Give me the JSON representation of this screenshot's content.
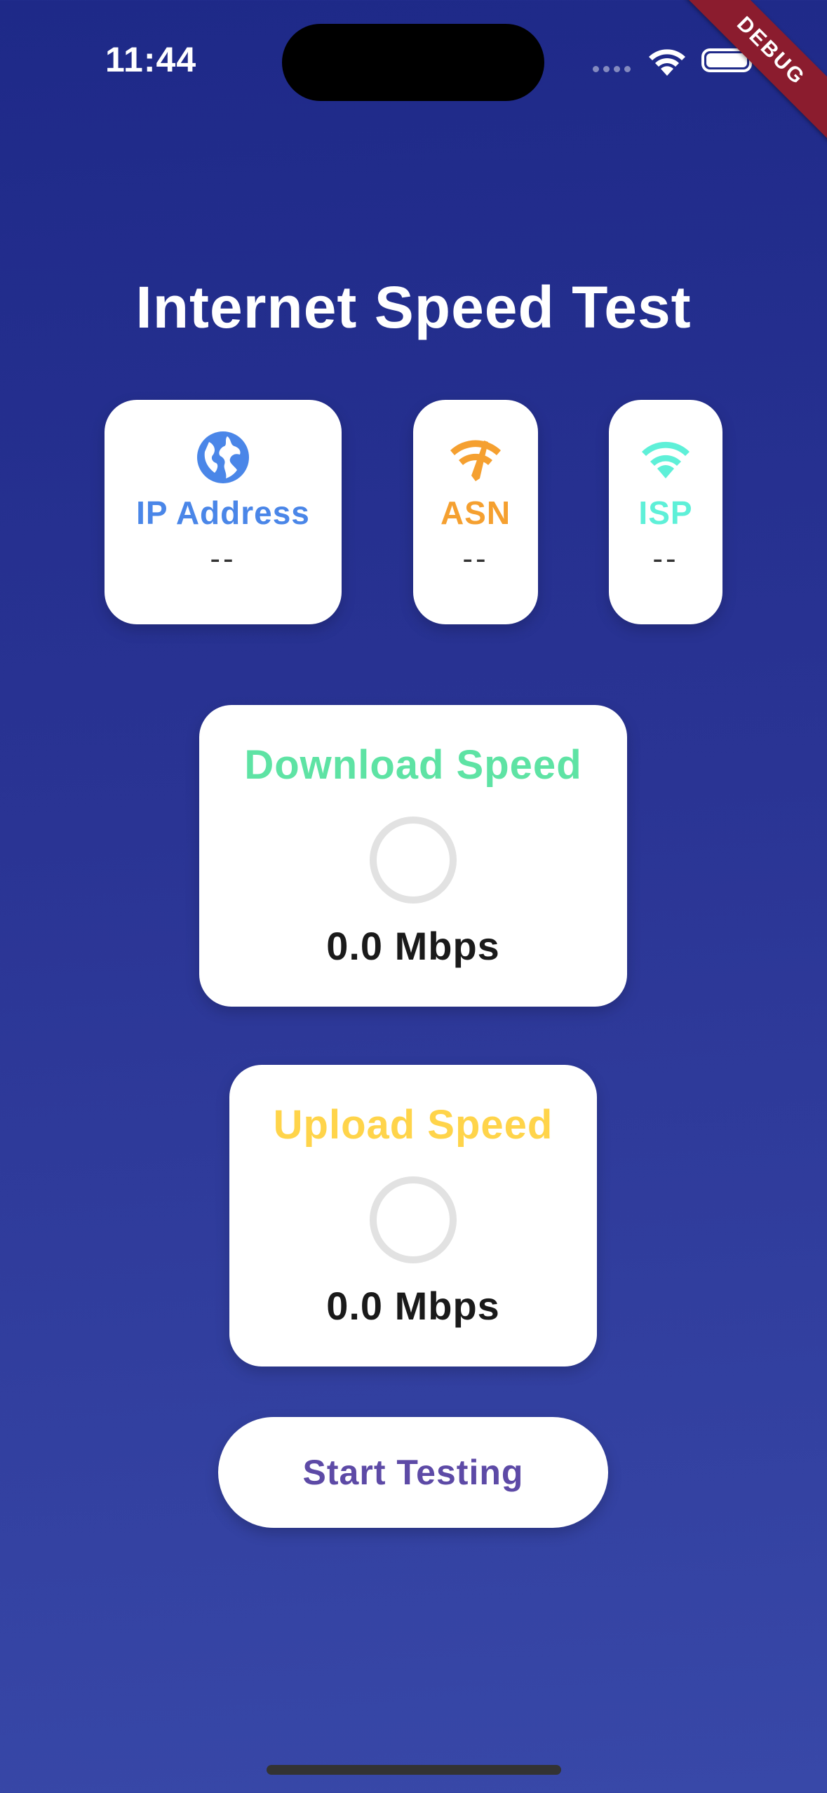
{
  "status_bar": {
    "time": "11:44"
  },
  "debug_banner": "DEBUG",
  "title": "Internet Speed Test",
  "info_cards": [
    {
      "label": "IP Address",
      "value": "--",
      "icon": "globe-icon",
      "color": "#4a86e8"
    },
    {
      "label": "ASN",
      "value": "--",
      "icon": "network-check-icon",
      "color": "#f5a030"
    },
    {
      "label": "ISP",
      "value": "--",
      "icon": "wifi-icon",
      "color": "#5ef0d8"
    }
  ],
  "download": {
    "title": "Download Speed",
    "value": "0.0 Mbps",
    "color": "#5ee3a4",
    "progress": 0
  },
  "upload": {
    "title": "Upload Speed",
    "value": "0.0 Mbps",
    "color": "#ffd44a",
    "progress": 0
  },
  "start_button": {
    "label": "Start Testing"
  },
  "colors": {
    "background_top": "#1e2988",
    "background_bottom": "#3848a8",
    "button_text": "#5d4aa6"
  }
}
